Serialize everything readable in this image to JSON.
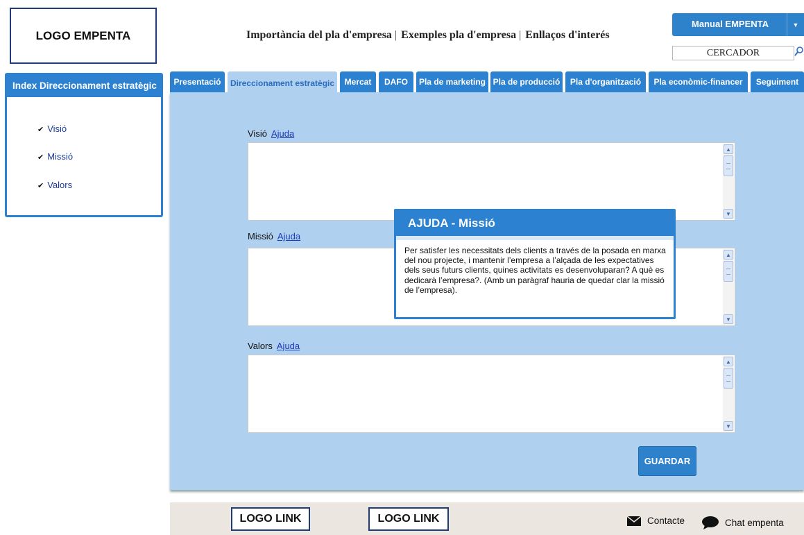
{
  "header": {
    "logo_text": "LOGO EMPENTA",
    "nav": [
      "Importància del pla d'empresa",
      "Exemples pla d'empresa",
      "Enllaços d'interés"
    ],
    "manual_button": "Manual EMPENTA",
    "search_value": "CERCADOR"
  },
  "sidebar": {
    "title": "Index Direccionament estratègic",
    "items": [
      {
        "label": "Visió",
        "icon": "check-icon"
      },
      {
        "label": "Missió",
        "icon": "check-icon"
      },
      {
        "label": "Valors",
        "icon": "check-icon"
      }
    ]
  },
  "tabs": [
    {
      "label": "Presentació",
      "active": false
    },
    {
      "label": "Direccionament estratègic",
      "active": true
    },
    {
      "label": "Mercat",
      "active": false
    },
    {
      "label": "DAFO",
      "active": false
    },
    {
      "label": "Pla de marketing",
      "active": false
    },
    {
      "label": "Pla de producció",
      "active": false
    },
    {
      "label": "Pla d'organització",
      "active": false
    },
    {
      "label": "Pla econòmic-financer",
      "active": false
    },
    {
      "label": "Seguiment",
      "active": false
    }
  ],
  "form": {
    "fields": [
      {
        "label": "Visió",
        "help": "Ajuda",
        "value": ""
      },
      {
        "label": "Missió",
        "help": "Ajuda",
        "value": ""
      },
      {
        "label": "Valors",
        "help": "Ajuda",
        "value": ""
      }
    ],
    "save_label": "GUARDAR"
  },
  "popup": {
    "title": "AJUDA -  Missió",
    "text": "Per satisfer les necessitats dels clients a través de la posada en marxa del nou projecte, i mantenir l’empresa a l’alçada de les expectatives dels seus futurs clients, quines activitats es desenvoluparan? A què es dedicarà l’empresa?. (Amb un paràgraf hauria de quedar clar la missió de l’empresa)."
  },
  "footer": {
    "logo_links": [
      "LOGO LINK",
      "LOGO LINK"
    ],
    "contact_label": "Contacte",
    "chat_label": "Chat empenta"
  },
  "colors": {
    "accent": "#2c82d0",
    "panel_bg": "#afd0ee",
    "footer_bg": "#ebe6df"
  }
}
